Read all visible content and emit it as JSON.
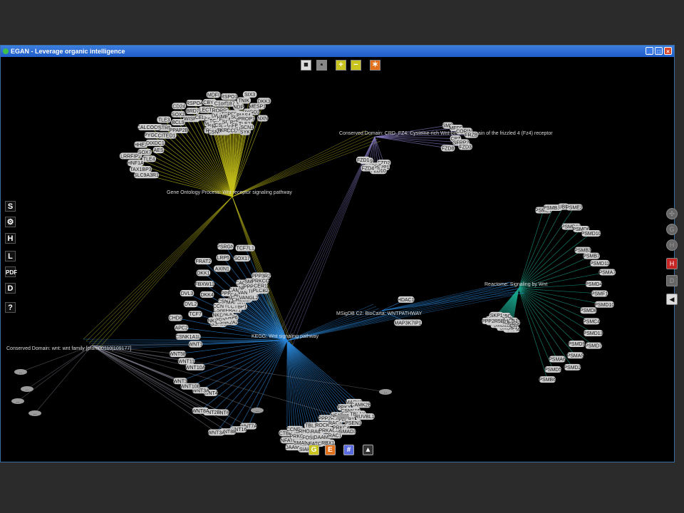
{
  "window": {
    "title": "EGAN - Leverage organic intelligence",
    "minimize": "_",
    "maximize": "□",
    "close": "×"
  },
  "toolbar_top": [
    {
      "label": "■",
      "bg": "#dddddd",
      "fg": "#222222"
    },
    {
      "label": "▪",
      "bg": "#888888",
      "fg": "#222222"
    },
    {
      "label": "+",
      "bg": "#c9c31e",
      "fg": "#ffffff"
    },
    {
      "label": "−",
      "bg": "#c9c31e",
      "fg": "#ffffff"
    },
    {
      "label": "✶",
      "bg": "#e2701b",
      "fg": "#ffffff"
    }
  ],
  "toolbar_left": [
    {
      "label": "S",
      "icon": "s-icon"
    },
    {
      "label": "⚙",
      "icon": "gear-icon"
    },
    {
      "label": "H",
      "icon": "h-icon"
    },
    {
      "label": "L",
      "icon": "l-icon"
    },
    {
      "label": "PDF",
      "icon": "pdf-icon"
    },
    {
      "label": "D",
      "icon": "d-icon"
    },
    {
      "label": "?",
      "icon": "help-icon"
    }
  ],
  "toolbar_right": [
    {
      "label": "✣",
      "icon": "move-icon"
    },
    {
      "label": "G",
      "icon": "g-icon"
    },
    {
      "label": "H",
      "icon": "h-icon"
    },
    {
      "label": "H",
      "icon": "h-red-icon"
    },
    {
      "label": "D",
      "icon": "d-icon"
    },
    {
      "label": "◀",
      "icon": "collapse-left-icon"
    }
  ],
  "toolbar_bottom": [
    {
      "label": "G",
      "bg": "#c9c31e"
    },
    {
      "label": "E",
      "bg": "#e2701b"
    },
    {
      "label": "#",
      "bg": "#5a6be0"
    },
    {
      "label": "▲",
      "bg": "#333333"
    }
  ],
  "colors": {
    "yellow": "#c7c21a",
    "blue": "#2a86d8",
    "teal": "#1aa58c",
    "purple": "#8a7fc8",
    "grey": "#8a8a9a"
  },
  "hubs": [
    {
      "id": "go",
      "label": "Gene Ontology Process: Wnt receptor signaling pathway",
      "color": "yellow"
    },
    {
      "id": "kegg",
      "label": "KEGG: Wnt signaling pathway",
      "color": "blue"
    },
    {
      "id": "reactome",
      "label": "Reactome: Signaling by Wnt",
      "color": "teal"
    },
    {
      "id": "crd",
      "label": "Conserved Domain: CRD_FZ4: Cysteine-rich Wnt-binding domain of the frizzled 4 (Fz4) receptor",
      "color": "purple"
    },
    {
      "id": "wntfam",
      "label": "Conserved Domain: wnt: wnt family [pfam00110|109177]",
      "color": "grey"
    },
    {
      "id": "msig",
      "label": "MSigDB C2: BioCarta: WNTPATHWAY",
      "color": "blue"
    }
  ],
  "nodes": {
    "go": [
      "SLC9A3R1",
      "TAX1BP3",
      "HNF1A",
      "LRRFIP2",
      "TLE4",
      "SOX7",
      "HHEX",
      "AES",
      "DIXDC1",
      "PYGO1",
      "CALCOCO1",
      "CITED1",
      "STRN",
      "TLE3",
      "PPAP2B",
      "BCL9",
      "SOX2",
      "CD24",
      "WISP1",
      "BRD7",
      "RSPO4",
      "CELSR2",
      "LECT2",
      "CBY1",
      "MDFI",
      "RORR2",
      "C1orf187",
      "RSPO1",
      "INVS",
      "NDP",
      "TNIK",
      "SIX3",
      "PYGO2",
      "MESP1",
      "DKK3",
      "NXN",
      "FGF9",
      "MDFIC",
      "LZTS2",
      "TREMENT1",
      "RSPO3",
      "CSNK1G3",
      "CSNK1G1",
      "RARG",
      "TGFB1I1",
      "DACT1",
      "ZEB2",
      "DNF138",
      "HBP1",
      "BARX1",
      "CSNK1G2",
      "FGF10",
      "TSC2",
      "UBE2B",
      "SOX17",
      "MESDC2",
      "KREMEN1",
      "LRP1",
      "MITF",
      "PFDN1",
      "FOXL1",
      "PITPR",
      "SOX17",
      "CCDC88C",
      "FBXW2",
      "GSC",
      "PIAS4",
      "LDB1",
      "TLE2",
      "PROP1",
      "SYK",
      "SCN1"
    ],
    "kegg": [
      "WNT7A",
      "WNT16",
      "WNT8B",
      "WNT3A",
      "WNT6",
      "WNT2B",
      "WNT8A",
      "WNT4",
      "WNT3A",
      "WNT10B",
      "WNT3",
      "WNT10A",
      "WNT11",
      "WNT5B",
      "WNT1",
      "CSNK1A1L",
      "APC2",
      "CHD8",
      "TCF7",
      "DVL2",
      "DVL3",
      "DKK4",
      "FBXW11",
      "DKK1",
      "FRAT2",
      "AXIN1",
      "LRP5",
      "PSRGN",
      "SOX17",
      "TCF7L1",
      "GSK3B",
      "NKD2",
      "CSNK2A2",
      "SENP2",
      "NKD1",
      "LRP6",
      "NLK",
      "CSNK2A1",
      "CCND1",
      "FRAT1",
      "TLE1",
      "CSNK1D",
      "CTBP1",
      "MAP3K7",
      "MYC",
      "PPP2R2A",
      "CREBBP",
      "CAMK2D",
      "CAMK2G",
      "VANGL2",
      "VANGL1",
      "NFAT5",
      "CACYBP",
      "TP53",
      "PPP3CB",
      "SMAD2",
      "PLCB2",
      "CER1",
      "PRKCG",
      "PPP3R2",
      "CTBP2",
      "NFATC2",
      "DAAM1",
      "CCND3",
      "PRKCB",
      "SMAD4",
      "SIAH1",
      "RHOA",
      "FOSL1",
      "NFATC3",
      "TBL1Y",
      "RAC2",
      "DAAM2",
      "RBX1",
      "ROCK1",
      "PRKACG",
      "RAC1",
      "PPP2R5E",
      "RAC3",
      "PRKCA",
      "SMAD3",
      "NFATC1",
      "PLCB1",
      "PSEN1",
      "PRKX",
      "CSNK1E",
      "TBL1X",
      "RUVBL1",
      "MAPK9",
      "CAMK2B"
    ],
    "reactome": [
      "PSME1",
      "PSMB14",
      "UBB",
      "PSME2",
      "PSMD12",
      "PSMD6",
      "PSMD10",
      "PSMB3",
      "PSMB7",
      "PSMD11",
      "PSMA7",
      "PSMD4",
      "PSMF1",
      "PSMD10",
      "PSMD8",
      "PSMC4",
      "PSMD13",
      "PSMD7",
      "PSMD9",
      "PSMA5",
      "PSMD2",
      "PSMA6",
      "PSMD5",
      "PSMB6",
      "PSMA4",
      "PSMC2",
      "PSMB4",
      "PSMD1",
      "PSMA1",
      "PSMA2",
      "PSMC5",
      "PSMB6",
      "PSMC3",
      "PSMB3",
      "PSMA3",
      "PSMC6",
      "PSMB1",
      "PSMD3",
      "PSMB2",
      "PPP2R1A",
      "PPP2CA",
      "PPP2R5D",
      "PPP2R5C",
      "CUL1",
      "PPP2CB",
      "PPP2R5B",
      "SKP1"
    ],
    "crd": [
      "SMO",
      "MFRP",
      "CORIN",
      "FRZB",
      "CPZ",
      "SFRP2",
      "FZD3",
      "FZD8",
      "FZD2",
      "SFRP1",
      "FZD10",
      "FZD7",
      "SFRP5",
      "FZD4",
      "FZD9",
      "FZD1"
    ],
    "msig": [
      "HDAC1",
      "MAP3K7IP1"
    ]
  },
  "collapsed_marker": "..."
}
